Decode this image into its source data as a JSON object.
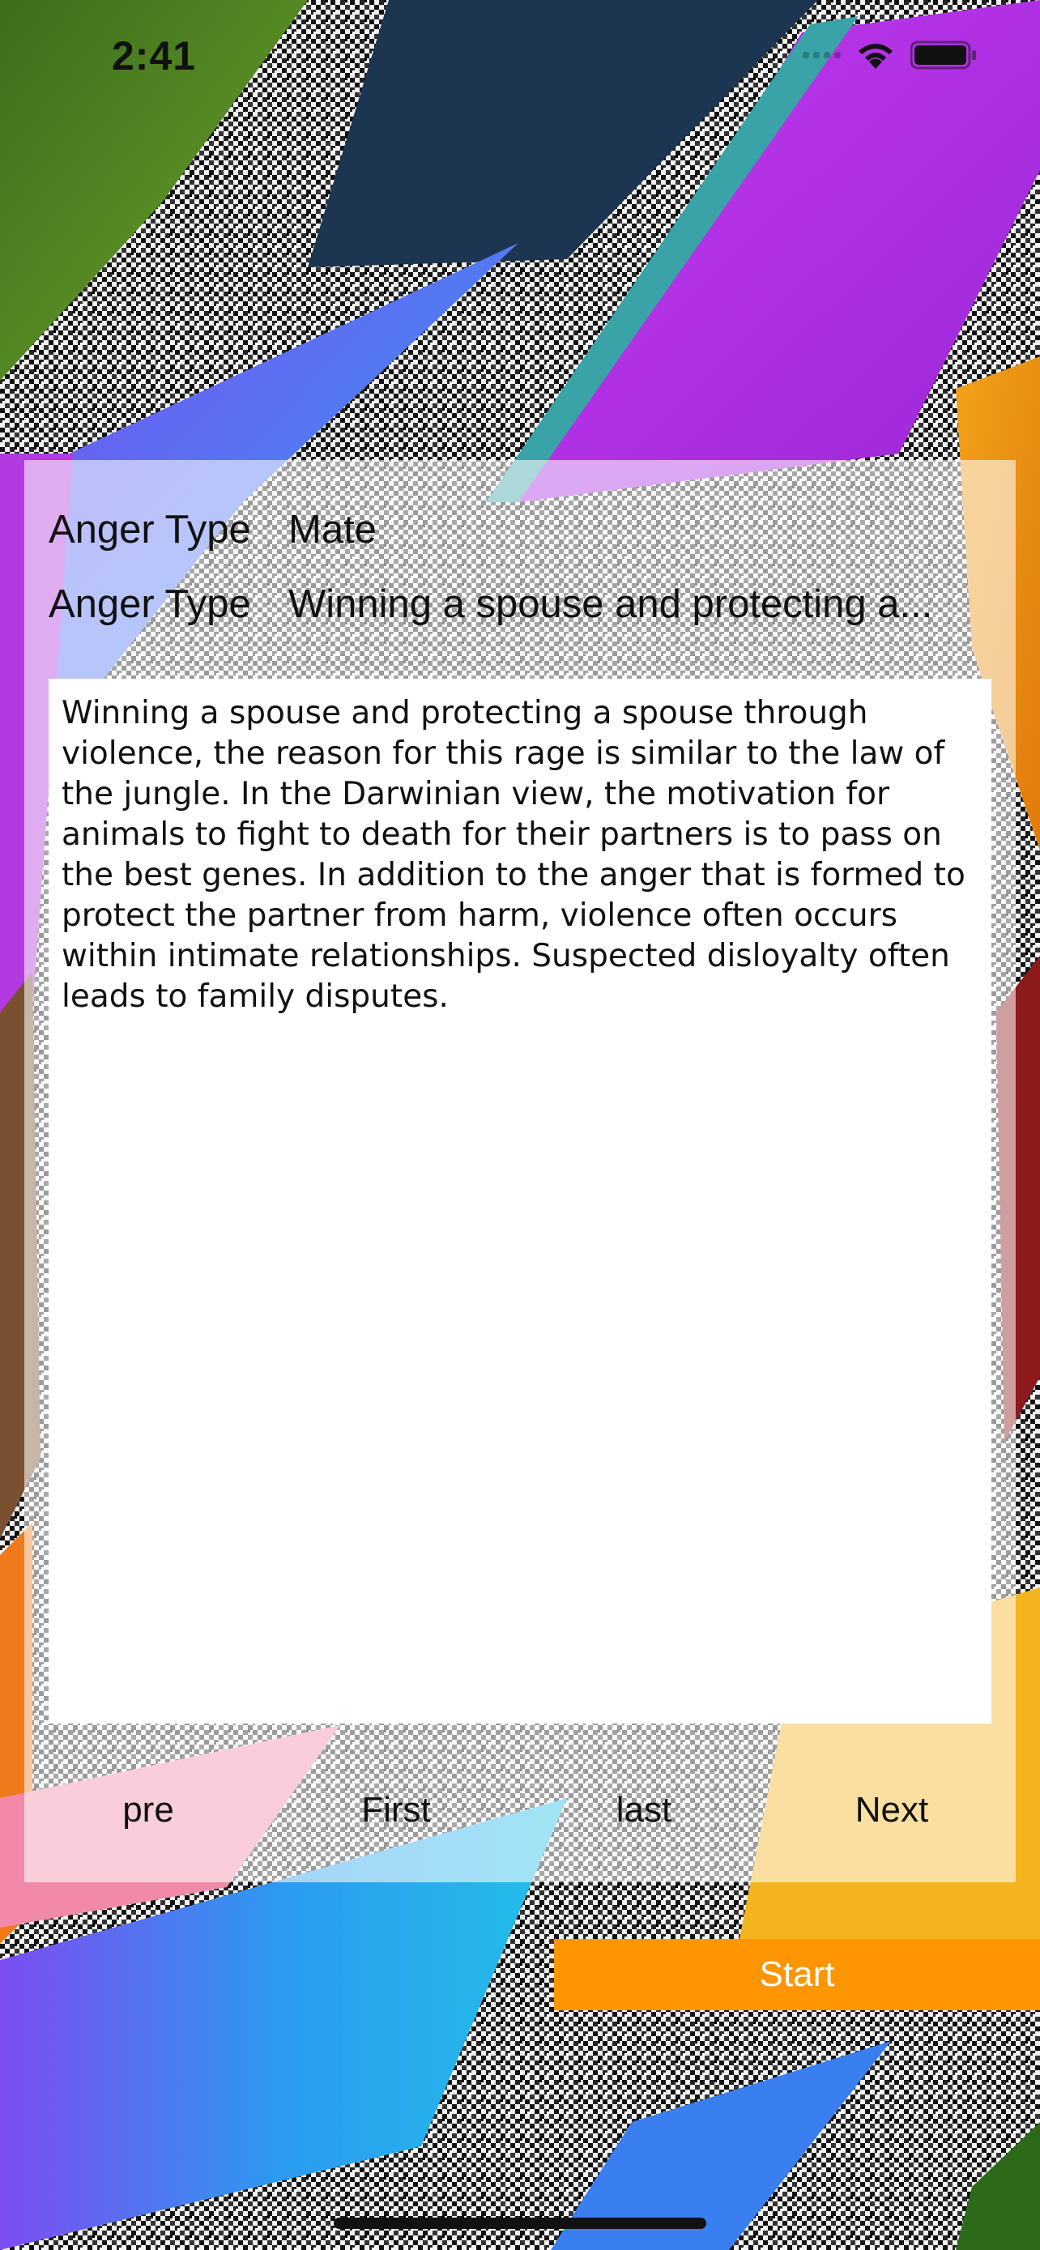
{
  "status_bar": {
    "time": "2:41",
    "icons": [
      "signal-icon",
      "wifi-icon",
      "battery-icon"
    ]
  },
  "details": {
    "row1": {
      "label": "Anger Type",
      "value": "Mate"
    },
    "row2": {
      "label": "Anger Type",
      "value": "Winning a spouse and protecting a..."
    }
  },
  "description": "Winning a spouse and protecting a spouse through violence, the reason for this rage is similar to the law of the jungle. In the Darwinian view, the motivation for animals to fight to death for their partners is to pass on the best genes. In addition to the anger that is formed to protect the partner from harm, violence often occurs within intimate relationships. Suspected disloyalty often leads to family disputes.",
  "navigation": {
    "pre": "pre",
    "first": "First",
    "last": "last",
    "next": "Next"
  },
  "start_button": "Start",
  "colors": {
    "accent": "#ff9500",
    "panel": "rgba(255,255,255,0.58)"
  }
}
